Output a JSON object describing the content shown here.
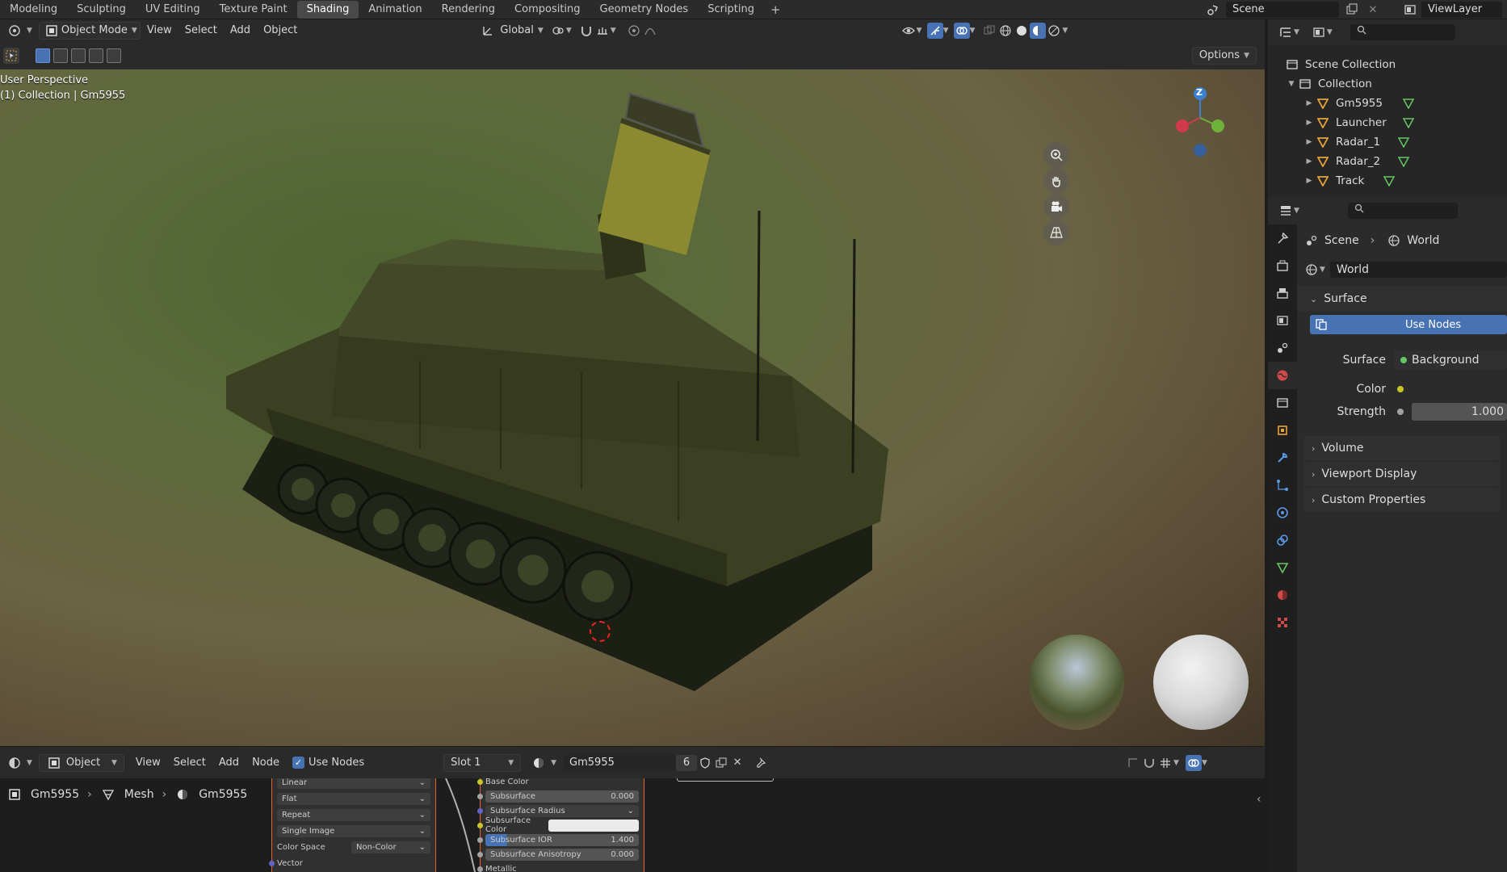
{
  "workspaces": [
    "Modeling",
    "Sculpting",
    "UV Editing",
    "Texture Paint",
    "Shading",
    "Animation",
    "Rendering",
    "Compositing",
    "Geometry Nodes",
    "Scripting"
  ],
  "active_workspace": "Shading",
  "add_workspace": "+",
  "scene_name": "Scene",
  "view_layer": "ViewLayer",
  "viewport": {
    "mode": "Object Mode",
    "menu": [
      "View",
      "Select",
      "Add",
      "Object"
    ],
    "orientation": "Global",
    "options": "Options",
    "overlay_line1": "User Perspective",
    "overlay_line2": "(1) Collection | Gm5955",
    "gizmo_z": "Z"
  },
  "node_editor": {
    "editor_type": "Object",
    "menu": [
      "View",
      "Select",
      "Add",
      "Node"
    ],
    "use_nodes_label": "Use Nodes",
    "slot": "Slot 1",
    "material": "Gm5955",
    "users": "6",
    "breadcrumb": [
      "Gm5955",
      "Mesh",
      "Gm5955"
    ],
    "image_node": {
      "rows": [
        "Linear",
        "Flat",
        "Repeat",
        "Single Image"
      ],
      "color_space_label": "Color Space",
      "color_space_value": "Non-Color",
      "vector": "Vector"
    },
    "bsdf_node": {
      "base_color": "Base Color",
      "subsurface": "Subsurface",
      "subsurface_value": "0.000",
      "subsurface_radius": "Subsurface Radius",
      "subsurface_color": "Subsurface Color",
      "subsurface_ior": "Subsurface IOR",
      "subsurface_ior_value": "1.400",
      "subsurface_anisotropy": "Subsurface Anisotropy",
      "subsurface_anisotropy_value": "0.000",
      "metallic": "Metallic"
    }
  },
  "outliner": {
    "root": "Scene Collection",
    "collection": "Collection",
    "objects": [
      "Gm5955",
      "Launcher",
      "Radar_1",
      "Radar_2",
      "Track"
    ]
  },
  "properties": {
    "breadcrumb_scene": "Scene",
    "breadcrumb_world": "World",
    "world_name": "World",
    "surface_panel": "Surface",
    "use_nodes": "Use Nodes",
    "surface_label": "Surface",
    "surface_value": "Background",
    "color_label": "Color",
    "strength_label": "Strength",
    "strength_value": "1.000",
    "panels": [
      "Volume",
      "Viewport Display",
      "Custom Properties"
    ]
  },
  "colors": {
    "accent": "#4772b3",
    "active_tab": "#494949",
    "socket_yellow": "#c7c729",
    "socket_grey": "#a1a1a1",
    "socket_green": "#63c763",
    "tab_world": "#d04a4a"
  }
}
